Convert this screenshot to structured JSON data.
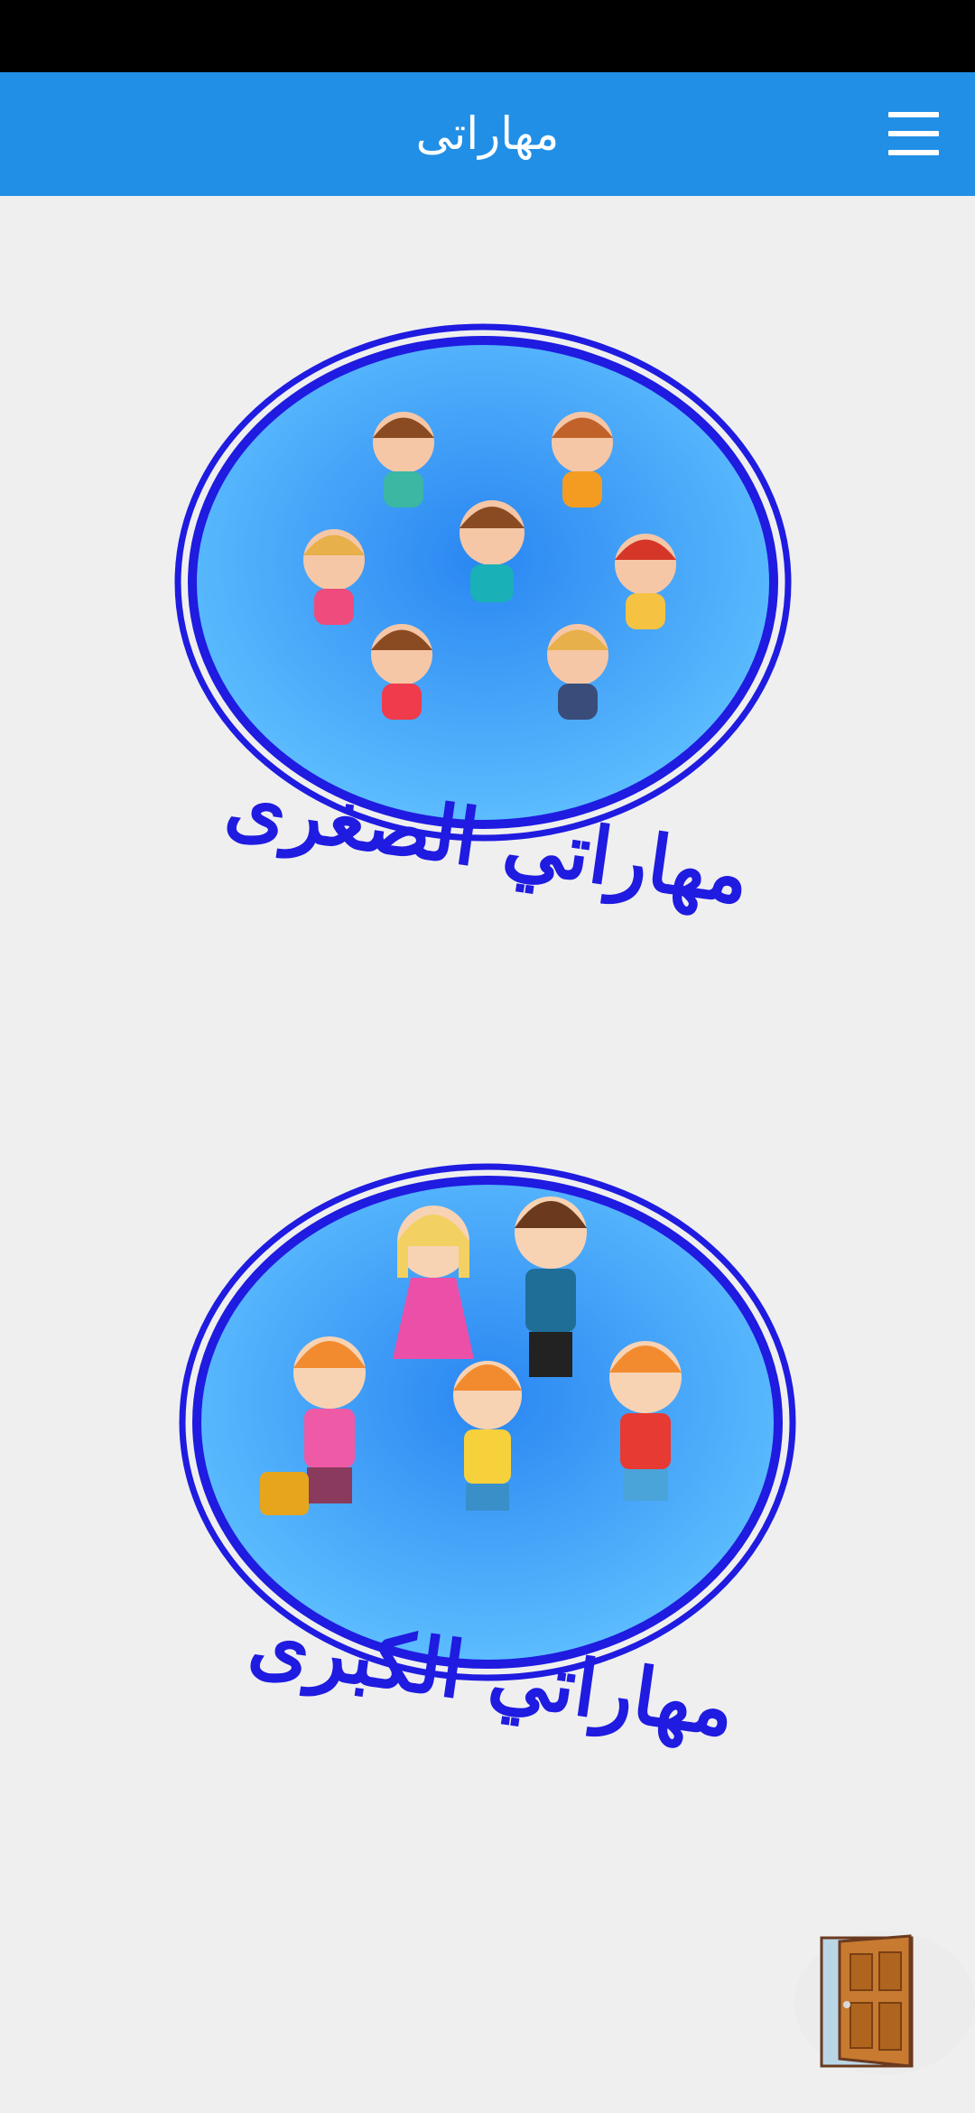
{
  "status_bar": {},
  "app_bar": {
    "title": "مهاراتى",
    "menu_icon": "hamburger-menu-icon"
  },
  "cards": [
    {
      "label": "مهاراتي الصغرى",
      "icon": "toddlers-circle-logo"
    },
    {
      "label": "مهاراتي الكبرى",
      "icon": "kids-circle-logo"
    }
  ],
  "exit": {
    "icon": "door-icon"
  },
  "colors": {
    "app_bar": "#218fe6",
    "background": "#efeff0",
    "logo_ring": "#1f1be0",
    "logo_fill": "#3aa7ff"
  }
}
